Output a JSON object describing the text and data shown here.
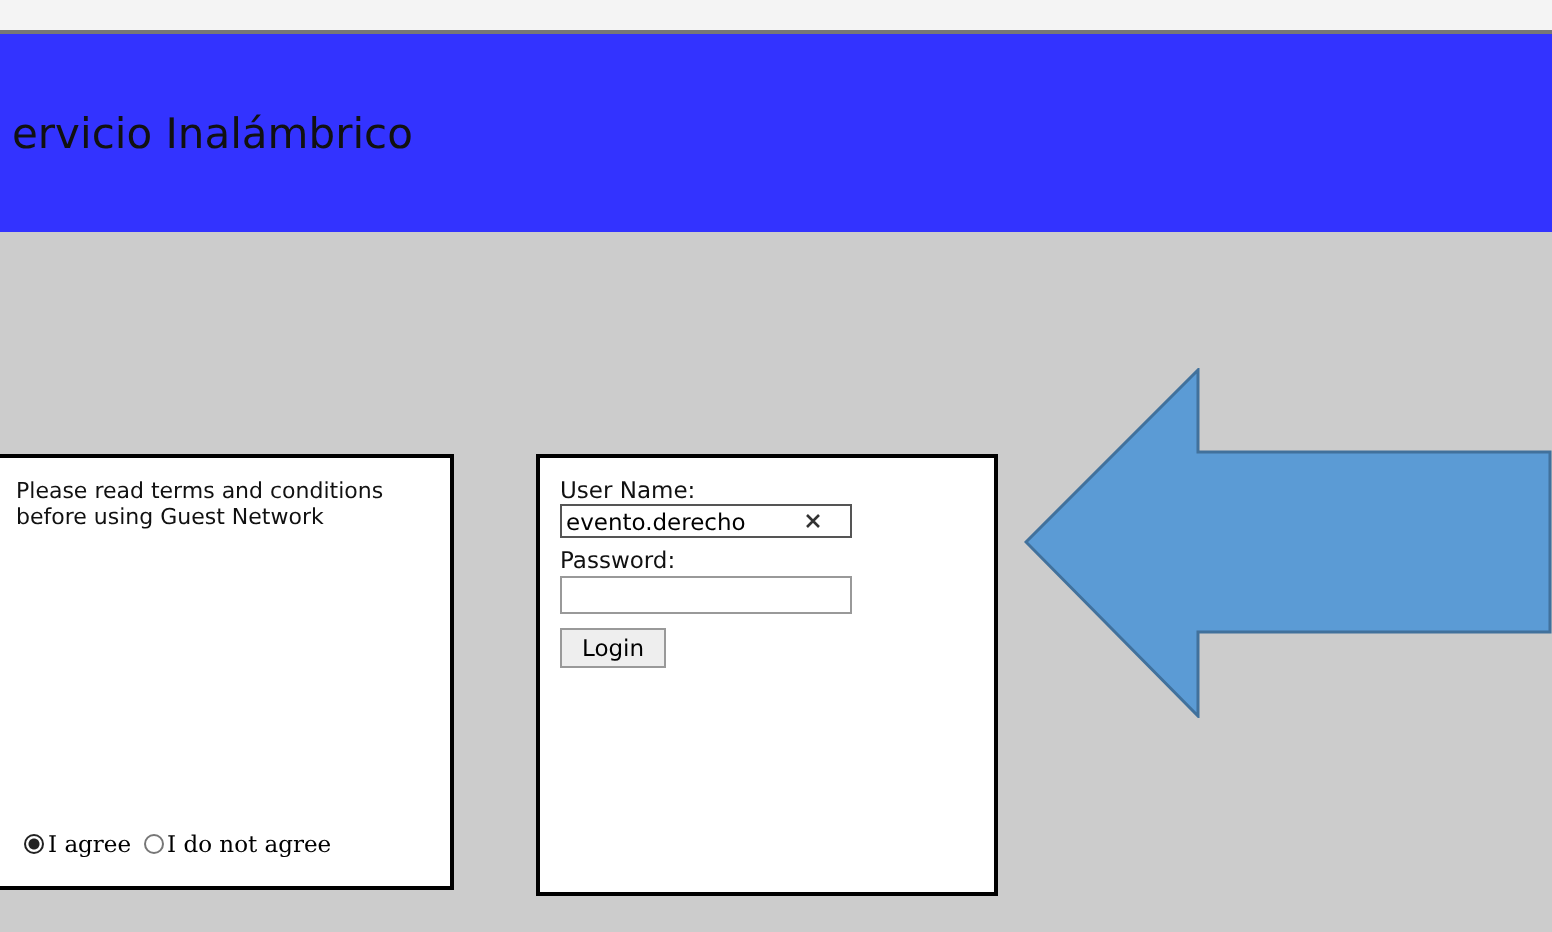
{
  "header": {
    "title": "ervicio Inalámbrico"
  },
  "terms": {
    "text": "Please read terms and conditions before using Guest Network",
    "options": [
      {
        "label": "I agree",
        "selected": true
      },
      {
        "label": "I do not agree",
        "selected": false
      }
    ]
  },
  "login": {
    "username_label": "User Name:",
    "username_value": "evento.derecho",
    "password_label": "Password:",
    "button": "Login"
  }
}
